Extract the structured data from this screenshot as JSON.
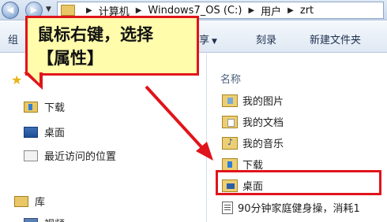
{
  "address_bar": {
    "crumbs": [
      "计算机",
      "Windows7_OS (C:)",
      "用户",
      "zrt"
    ]
  },
  "toolbar": {
    "organize_label": "组",
    "share_label": "享",
    "burn_label": "刻录",
    "new_folder_label": "新建文件夹"
  },
  "nav_pane": {
    "favorites_label": "收藏夹",
    "items": [
      {
        "label": "下载",
        "icon": "download-folder-icon"
      },
      {
        "label": "桌面",
        "icon": "desktop-icon"
      },
      {
        "label": "最近访问的位置",
        "icon": "recent-places-icon"
      }
    ],
    "libraries_label": "库",
    "library_items": [
      {
        "label": "视频",
        "icon": "video-library-icon"
      }
    ]
  },
  "file_pane": {
    "column_name": "名称",
    "files": [
      {
        "label": "我的图片",
        "icon": "pictures-folder-icon"
      },
      {
        "label": "我的文档",
        "icon": "documents-folder-icon"
      },
      {
        "label": "我的音乐",
        "icon": "music-folder-icon"
      },
      {
        "label": "下载",
        "icon": "downloads-folder-icon"
      },
      {
        "label": "桌面",
        "icon": "desktop-folder-icon",
        "selected": true
      },
      {
        "label": "90分钟家庭健身操，消耗1",
        "icon": "text-file-icon"
      }
    ]
  },
  "callout": {
    "line1": "鼠标右键，选择",
    "line2": "【属性】"
  },
  "colors": {
    "callout_fill": "#fffcab",
    "annotation_red": "#e0141b"
  }
}
